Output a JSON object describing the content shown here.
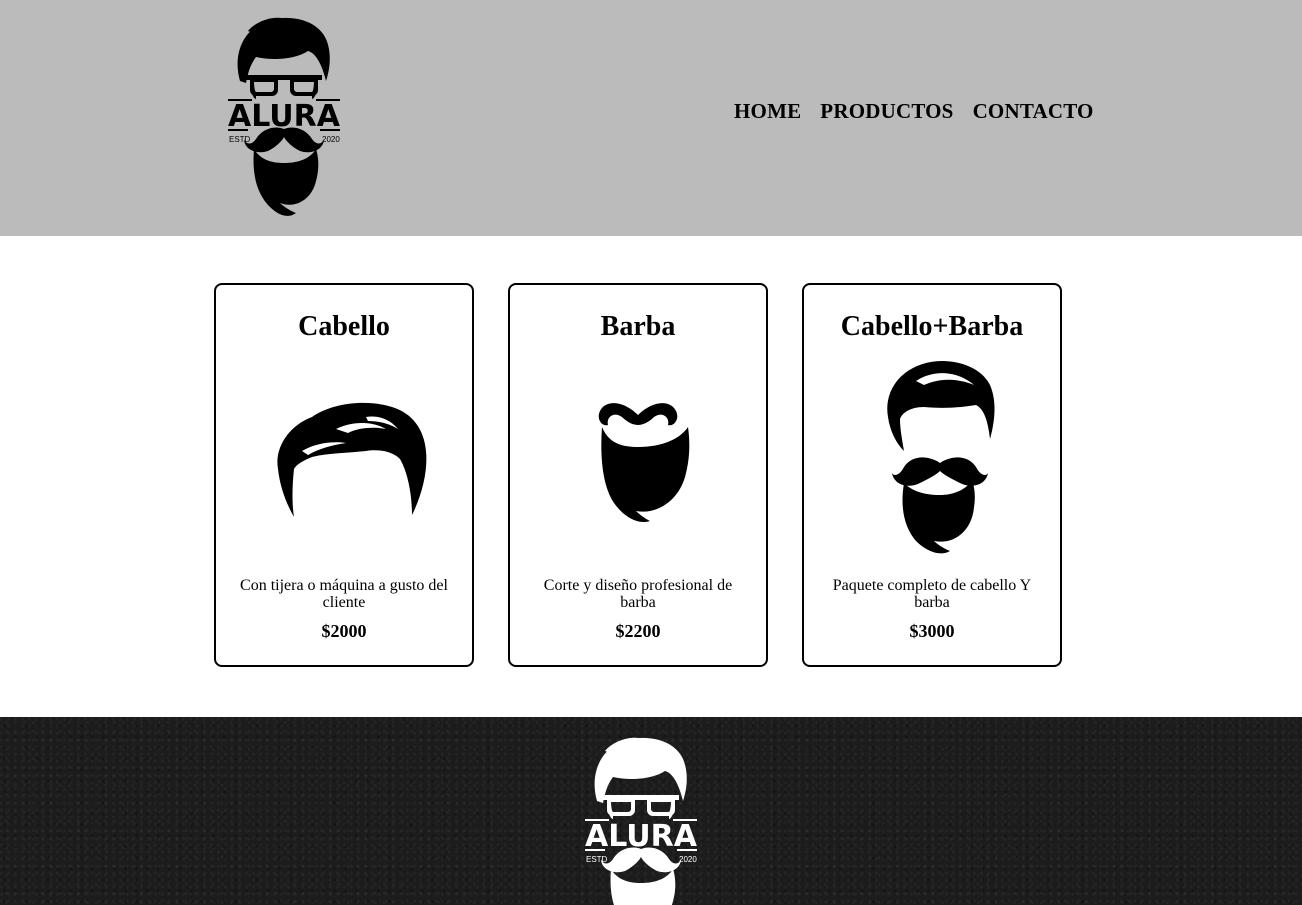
{
  "header": {
    "logo": {
      "brand": "ALURA",
      "estd": "ESTD",
      "year": "2020",
      "icon": "barber-logo-icon"
    },
    "nav": [
      {
        "label": "HOME"
      },
      {
        "label": "PRODUCTOS"
      },
      {
        "label": "CONTACTO"
      }
    ],
    "background": "#bbbbbb"
  },
  "products": [
    {
      "title": "Cabello",
      "description": "Con tijera o máquina a gusto del cliente",
      "price": "$2000",
      "icon": "hair-icon"
    },
    {
      "title": "Barba",
      "description": "Corte y diseño profesional de barba",
      "price": "$2200",
      "icon": "beard-icon"
    },
    {
      "title": "Cabello+Barba",
      "description": "Paquete completo de cabello Y barba",
      "price": "$3000",
      "icon": "hair-and-beard-icon"
    }
  ],
  "footer": {
    "logo": {
      "brand": "ALURA",
      "estd": "ESTD",
      "year": "2020",
      "icon": "barber-logo-icon"
    },
    "background": "#1c1c1c"
  }
}
